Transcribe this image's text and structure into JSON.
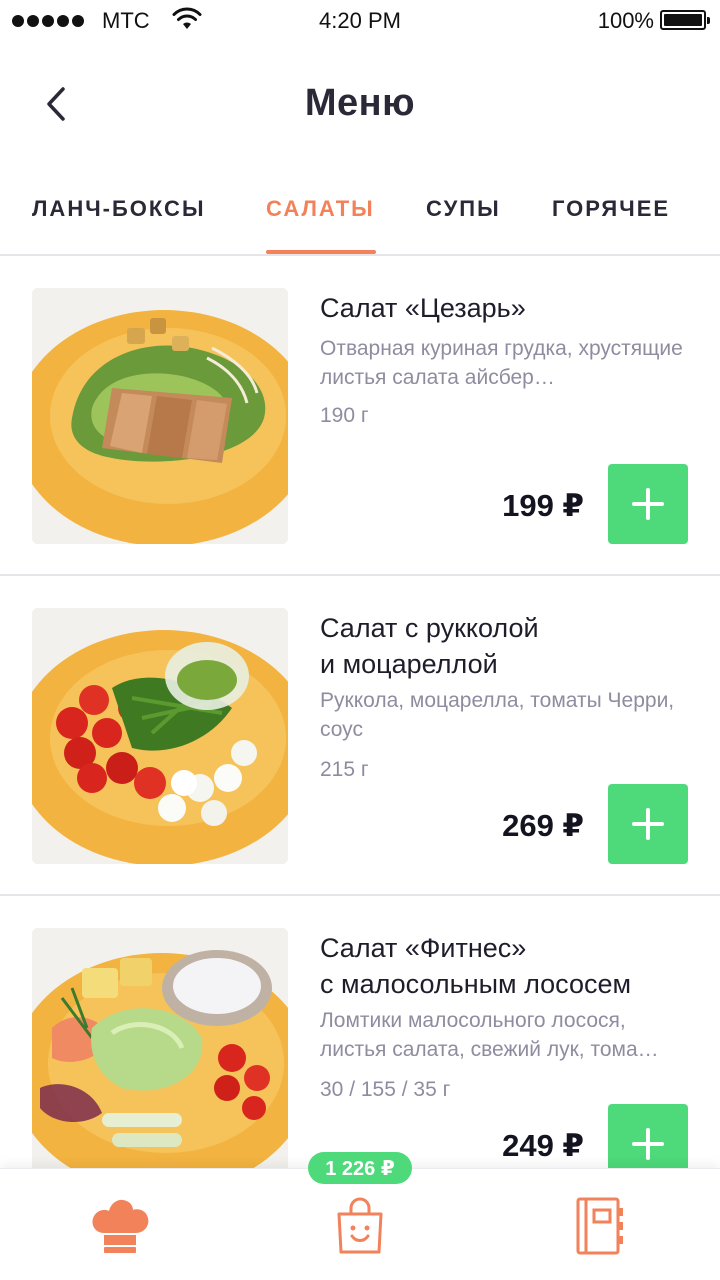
{
  "status_bar": {
    "carrier": "МТС",
    "time": "4:20 PM",
    "battery": "100%"
  },
  "header": {
    "title": "Меню"
  },
  "tabs": [
    {
      "label": "ЛАНЧ-БОКСЫ",
      "active": false
    },
    {
      "label": "САЛАТЫ",
      "active": true
    },
    {
      "label": "СУПЫ",
      "active": false
    },
    {
      "label": "ГОРЯЧЕЕ",
      "active": false
    }
  ],
  "items": [
    {
      "name": "Салат  «Цезарь»",
      "description": "Отварная куриная грудка, хрустящие листья салата айсбер…",
      "weight": "190 г",
      "price": "199 ₽"
    },
    {
      "name": "Салат с рукколой\nи моцареллой",
      "description": "Руккола, моцарелла, томаты Черри, соус",
      "weight": "215 г",
      "price": "269 ₽"
    },
    {
      "name": "Салат «Фитнес»\nс малосольным лососем",
      "description": "Ломтики малосольного лосося, листья салата, свежий лук, тома…",
      "weight": "30 / 155 / 35 г",
      "price": "249 ₽"
    }
  ],
  "cart": {
    "total": "1 226 ₽"
  },
  "tabbar": {
    "icons": [
      "chef-hat-icon",
      "shopping-bag-icon",
      "notebook-icon"
    ]
  },
  "colors": {
    "accent": "#f2825a",
    "add_button": "#4ed97a",
    "text_dark": "#2b2838",
    "text_muted": "#8f8ca0"
  }
}
